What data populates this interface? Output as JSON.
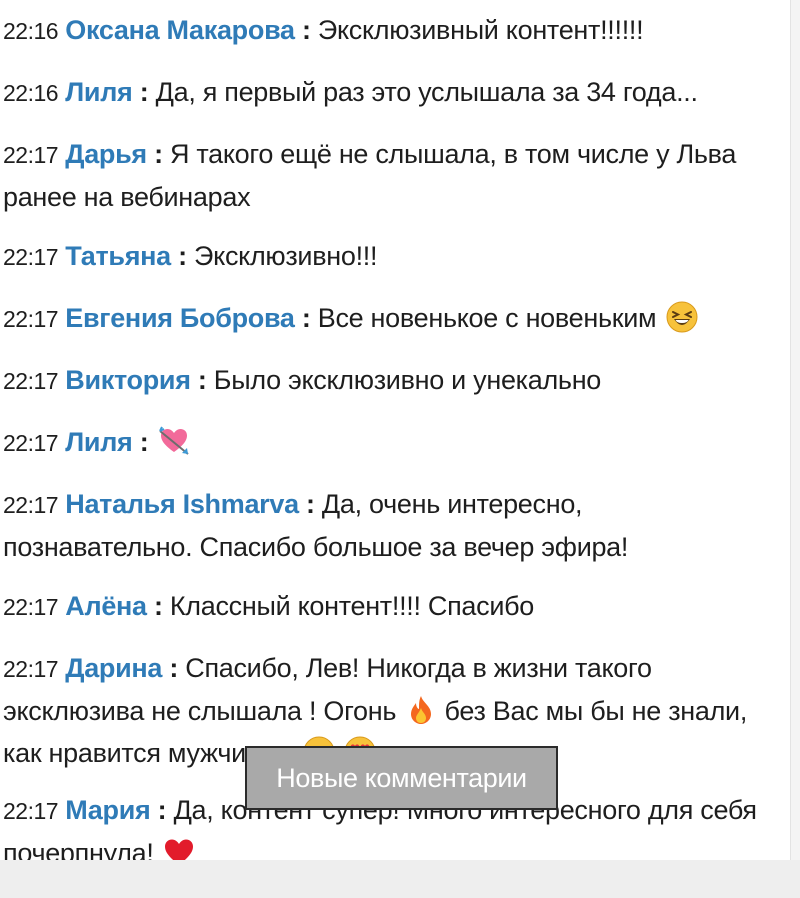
{
  "messages": [
    {
      "time": "22:16",
      "author": "Оксана Макарова",
      "sep": ":",
      "text": "Эксклюзивный контент!!!!!!"
    },
    {
      "time": "22:16",
      "author": "Лиля",
      "sep": ":",
      "text": "Да, я первый раз это услышала за 34 года..."
    },
    {
      "time": "22:17",
      "author": "Дарья",
      "sep": ":",
      "text": "Я такого ещё не слышала, в том числе у Льва ранее на вебинарах"
    },
    {
      "time": "22:17",
      "author": "Татьяна",
      "sep": ":",
      "text": "Эксклюзивно!!!"
    },
    {
      "time": "22:17",
      "author": "Евгения Боброва",
      "sep": ":",
      "text": "Все новенькое с новеньким",
      "emoji_after": "grinning-squint-face-emoji"
    },
    {
      "time": "22:17",
      "author": "Виктория",
      "sep": ":",
      "text": "Было эксклюзивно и унекально"
    },
    {
      "time": "22:17",
      "author": "Лиля",
      "sep": ":",
      "text": "",
      "emoji_after": "heart-with-arrow-emoji"
    },
    {
      "time": "22:17",
      "author": "Наталья Ishmarva",
      "sep": ":",
      "text": "Да, очень интересно, познавательно. Спасибо большое за вечер эфира!"
    },
    {
      "time": "22:17",
      "author": "Алёна",
      "sep": ":",
      "text": "Классный контент!!!! Спасибо"
    },
    {
      "time": "22:17",
      "author": "Дарина",
      "sep": ":",
      "text_part1": "Спасибо, Лев! Никогда в жизни такого эксклюзива не слышала ! Огонь",
      "emoji_mid": "fire-emoji",
      "text_part2": "без Вас мы бы не знали, как нравится мужчинам",
      "emoji_end": [
        "smiling-face-emoji",
        "heart-eyes-emoji"
      ]
    },
    {
      "time": "22:17",
      "author": "Мария",
      "sep": ":",
      "text": "Да, контент супер! Много интересного для себя почерпнула!",
      "emoji_after": "red-heart-emoji"
    }
  ],
  "new_comments_button": {
    "label": "Новые комментарии"
  },
  "colors": {
    "author": "#2f7bb7",
    "text": "#1e1e1e",
    "button_bg": "#a9a9a9"
  }
}
